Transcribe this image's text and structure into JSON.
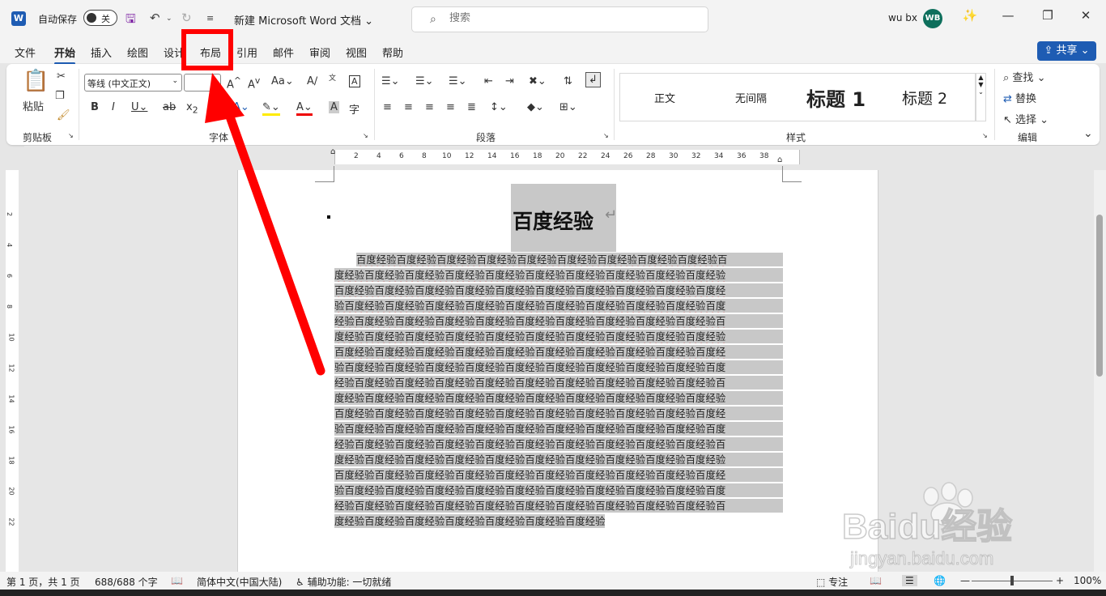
{
  "app": {
    "autosave_label": "自动保存",
    "autosave_state": "关",
    "doc_title": "新建 Microsoft Word 文档",
    "search_placeholder": "搜索",
    "user_name": "wu bx",
    "user_initials": "WB"
  },
  "tabs": [
    "文件",
    "开始",
    "插入",
    "绘图",
    "设计",
    "布局",
    "引用",
    "邮件",
    "审阅",
    "视图",
    "帮助"
  ],
  "active_tab": "开始",
  "share_label": "共享",
  "ribbon": {
    "clipboard": {
      "paste": "粘贴",
      "group_label": "剪贴板"
    },
    "font": {
      "font_name": "等线 (中文正文)",
      "font_size": "",
      "group_label": "字体"
    },
    "paragraph": {
      "group_label": "段落"
    },
    "styles": {
      "items": [
        "正文",
        "无间隔",
        "标题 1",
        "标题 2"
      ],
      "group_label": "样式"
    },
    "editing": {
      "find": "查找",
      "replace": "替换",
      "select": "选择",
      "group_label": "编辑"
    }
  },
  "ruler": {
    "h_ticks": [
      "2",
      "4",
      "6",
      "8",
      "10",
      "12",
      "14",
      "16",
      "18",
      "20",
      "22",
      "24",
      "26",
      "28",
      "30",
      "32",
      "34",
      "36",
      "38"
    ],
    "v_ticks": [
      "2",
      "4",
      "6",
      "8",
      "10",
      "12",
      "14",
      "16",
      "18",
      "20",
      "22"
    ]
  },
  "document": {
    "heading": "百度经验",
    "lines": [
      "百度经验百度经验百度经验百度经验百度经验百度经验百度经验百度经验百度经验百",
      "度经验百度经验百度经验百度经验百度经验百度经验百度经验百度经验百度经验百度经验",
      "百度经验百度经验百度经验百度经验百度经验百度经验百度经验百度经验百度经验百度经",
      "验百度经验百度经验百度经验百度经验百度经验百度经验百度经验百度经验百度经验百度",
      "经验百度经验百度经验百度经验百度经验百度经验百度经验百度经验百度经验百度经验百",
      "度经验百度经验百度经验百度经验百度经验百度经验百度经验百度经验百度经验百度经验",
      "百度经验百度经验百度经验百度经验百度经验百度经验百度经验百度经验百度经验百度经",
      "验百度经验百度经验百度经验百度经验百度经验百度经验百度经验百度经验百度经验百度",
      "经验百度经验百度经验百度经验百度经验百度经验百度经验百度经验百度经验百度经验百",
      "度经验百度经验百度经验百度经验百度经验百度经验百度经验百度经验百度经验百度经验",
      "百度经验百度经验百度经验百度经验百度经验百度经验百度经验百度经验百度经验百度经",
      "验百度经验百度经验百度经验百度经验百度经验百度经验百度经验百度经验百度经验百度",
      "经验百度经验百度经验百度经验百度经验百度经验百度经验百度经验百度经验百度经验百",
      "度经验百度经验百度经验百度经验百度经验百度经验百度经验百度经验百度经验百度经验",
      "百度经验百度经验百度经验百度经验百度经验百度经验百度经验百度经验百度经验百度经",
      "验百度经验百度经验百度经验百度经验百度经验百度经验百度经验百度经验百度经验百度",
      "经验百度经验百度经验百度经验百度经验百度经验百度经验百度经验百度经验百度经验百",
      "度经验百度经验百度经验百度经验百度经验百度经验百度经验百度经验↵"
    ]
  },
  "status": {
    "page": "第 1 页，共 1 页",
    "words": "688/688 个字",
    "language": "简体中文(中国大陆)",
    "accessibility": "辅助功能: 一切就绪",
    "focus": "专注",
    "zoom": "100%"
  },
  "watermark": {
    "brand": "Baidu经验",
    "url": "jingyan.baidu.com"
  },
  "colors": {
    "accent": "#1e5cb3",
    "annotation": "#ff0000",
    "selection": "#c8c8c8"
  }
}
